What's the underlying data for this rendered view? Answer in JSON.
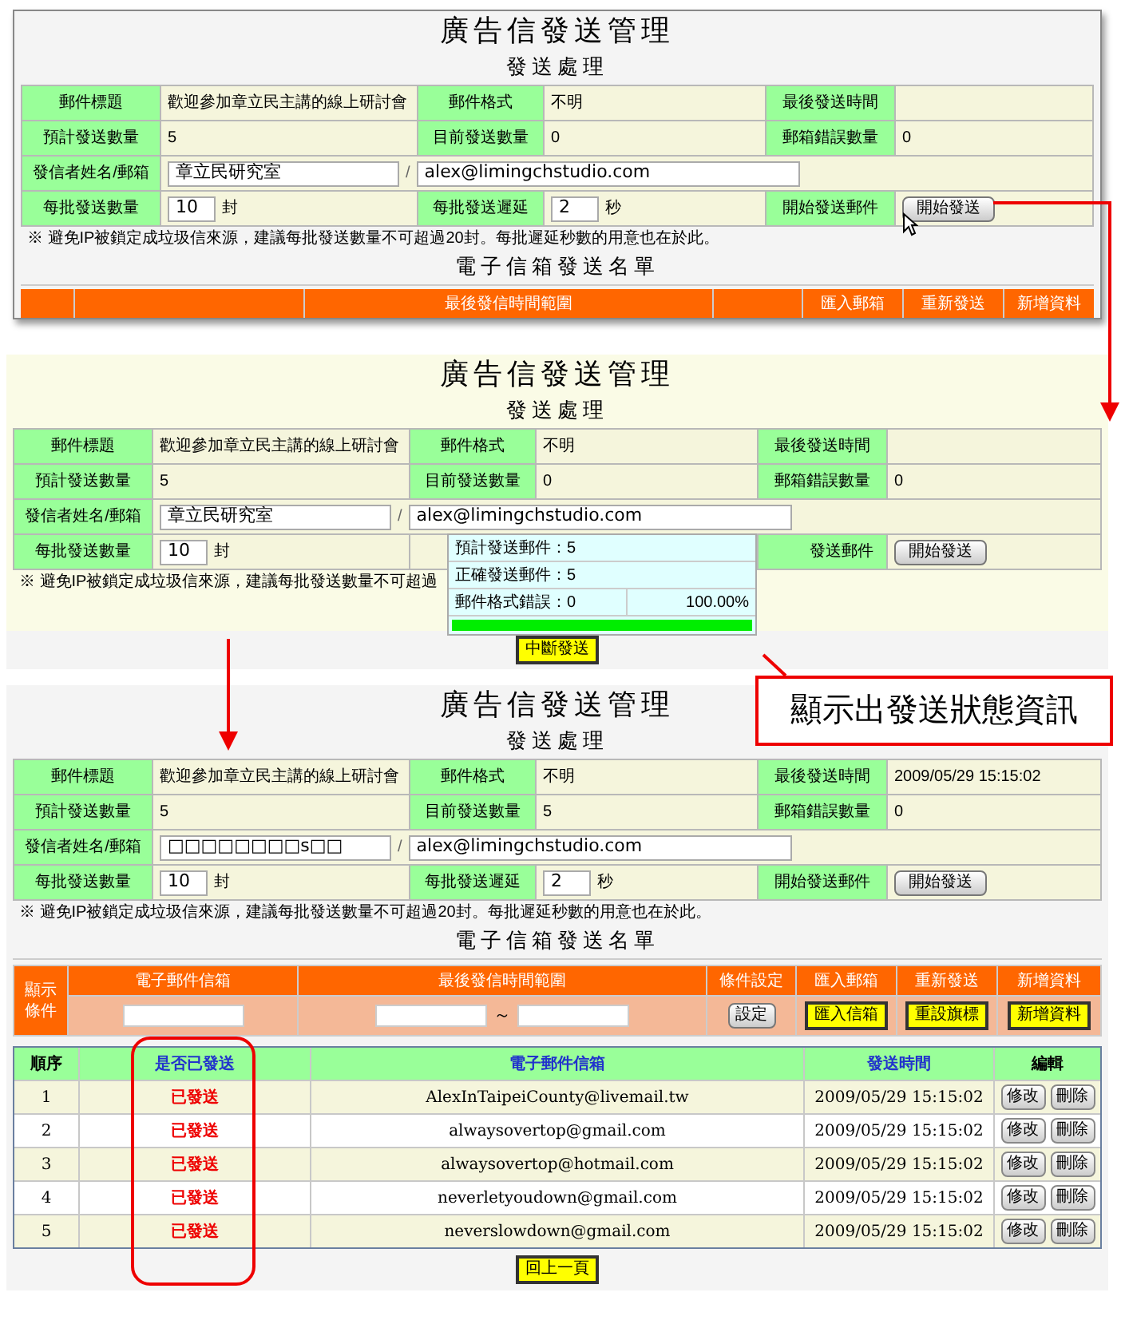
{
  "panels": [
    {
      "title": "廣告信發送管理",
      "subtitle": "發送處理",
      "form": {
        "subject_label": "郵件標題",
        "subject": "歡迎參加章立民主講的線上研討會",
        "format_label": "郵件格式",
        "format": "不明",
        "last_sent_label": "最後發送時間",
        "planned_label": "預計發送數量",
        "planned": "5",
        "current_label": "目前發送數量",
        "current": "0",
        "errors_label": "郵箱錯誤數量",
        "errors": "0",
        "sender_label": "發信者姓名/郵箱",
        "sender_name": "章立民研究室",
        "separator": "/",
        "sender_email": "alex@limingchstudio.com",
        "batch_label": "每批發送數量",
        "batch_size": "10",
        "batch_unit": "封",
        "delay_label": "每批發送遲延",
        "delay": "2",
        "delay_unit": "秒",
        "start_label": "開始發送郵件",
        "start_button": "開始發送"
      },
      "note": "※ 避免IP被鎖定成垃圾信來源，建議每批發送數量不可超過20封。每批遲延秒數的用意也在於此。",
      "list_title": "電子信箱發送名單",
      "partial_header": {
        "range": "最後發信時間範圍",
        "import": "匯入郵箱",
        "resend": "重新發送",
        "add": "新增資料"
      },
      "cursor": true
    },
    {
      "title": "廣告信發送管理",
      "subtitle": "發送處理",
      "form": {
        "subject_label": "郵件標題",
        "subject": "歡迎參加章立民主講的線上研討會",
        "format_label": "郵件格式",
        "format": "不明",
        "last_sent_label": "最後發送時間",
        "planned_label": "預計發送數量",
        "planned": "5",
        "current_label": "目前發送數量",
        "current": "0",
        "errors_label": "郵箱錯誤數量",
        "errors": "0",
        "sender_label": "發信者姓名/郵箱",
        "sender_name": "章立民研究室",
        "separator": "/",
        "sender_email": "alex@limingchstudio.com",
        "batch_label": "每批發送數量",
        "batch_size": "10",
        "batch_unit": "封",
        "start_label": "發送郵件",
        "start_button": "開始發送"
      },
      "note": "※ 避免IP被鎖定成垃圾信來源，建議每批發送數量不可超過",
      "progress": {
        "lines": [
          "預計發送郵件：5",
          "正確發送郵件：5",
          "郵件格式錯誤：0"
        ],
        "percent": "100.00%",
        "level": 1
      },
      "stop_button": "中斷發送"
    },
    {
      "title": "廣告信發送管理",
      "subtitle": "發送處理",
      "form": {
        "subject_label": "郵件標題",
        "subject": "歡迎參加章立民主講的線上研討會",
        "format_label": "郵件格式",
        "format": "不明",
        "last_sent_label": "最後發送時間",
        "last_sent": "2009/05/29 15:15:02",
        "planned_label": "預計發送數量",
        "planned": "5",
        "current_label": "目前發送數量",
        "current": "5",
        "errors_label": "郵箱錯誤數量",
        "errors": "0",
        "sender_label": "發信者姓名/郵箱",
        "sender_name": "□□□□□□□□s□□",
        "separator": "/",
        "sender_email": "alex@limingchstudio.com",
        "batch_label": "每批發送數量",
        "batch_size": "10",
        "batch_unit": "封",
        "delay_label": "每批發送遲延",
        "delay": "2",
        "delay_unit": "秒",
        "start_label": "開始發送郵件",
        "start_button": "開始發送"
      },
      "note": "※ 避免IP被鎖定成垃圾信來源，建議每批發送數量不可超過20封。每批遲延秒數的用意也在於此。",
      "list_title": "電子信箱發送名單",
      "filter": {
        "label": "顯示條件",
        "columns": [
          "電子郵件信箱",
          "最後發信時間範圍",
          "條件設定",
          "匯入郵箱",
          "重新發送",
          "新增資料"
        ],
        "tilde": "～",
        "buttons": [
          "設定",
          "匯入信箱",
          "重設旗標",
          "新增資料"
        ]
      },
      "table": {
        "columns": [
          "順序",
          "是否已發送",
          "電子郵件信箱",
          "發送時間",
          "編輯"
        ],
        "rows": [
          {
            "no": "1",
            "status": "已發送",
            "email": "AlexInTaipeiCounty@livemail.tw",
            "time": "2009/05/29 15:15:02",
            "actions": [
              "修改",
              "刪除"
            ]
          },
          {
            "no": "2",
            "status": "已發送",
            "email": "alwaysovertop@gmail.com",
            "time": "2009/05/29 15:15:02",
            "actions": [
              "修改",
              "刪除"
            ]
          },
          {
            "no": "3",
            "status": "已發送",
            "email": "alwaysovertop@hotmail.com",
            "time": "2009/05/29 15:15:02",
            "actions": [
              "修改",
              "刪除"
            ]
          },
          {
            "no": "4",
            "status": "已發送",
            "email": "neverletyoudown@gmail.com",
            "time": "2009/05/29 15:15:02",
            "actions": [
              "修改",
              "刪除"
            ]
          },
          {
            "no": "5",
            "status": "已發送",
            "email": "neverslowdown@gmail.com",
            "time": "2009/05/29 15:15:02",
            "actions": [
              "修改",
              "刪除"
            ]
          }
        ]
      },
      "back_button": "回上一頁"
    }
  ],
  "callout": "顯示出發送狀態資訊"
}
